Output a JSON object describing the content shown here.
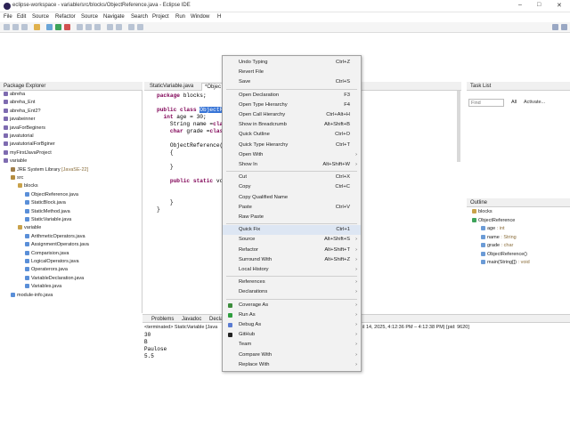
{
  "window": {
    "title": "eclipse-workspace - variable/src/blocks/ObjectReference.java - Eclipse IDE",
    "minimize": "–",
    "maximize": "□",
    "close": "✕"
  },
  "menubar": [
    "File",
    "Edit",
    "Source",
    "Refactor",
    "Source",
    "Navigate",
    "Search",
    "Project",
    "Run",
    "Window",
    "H"
  ],
  "package_explorer": {
    "tab_label": "Package Explorer",
    "items": [
      {
        "label": "abreha",
        "depth": 0,
        "type": "proj"
      },
      {
        "label": "abreha_Ent",
        "depth": 0,
        "type": "proj"
      },
      {
        "label": "abreha_Ent2?",
        "depth": 0,
        "type": "proj"
      },
      {
        "label": "javabeinner",
        "depth": 0,
        "type": "proj"
      },
      {
        "label": "javaForBeginers",
        "depth": 0,
        "type": "proj"
      },
      {
        "label": "javatutorial",
        "depth": 0,
        "type": "proj"
      },
      {
        "label": "javatutorialForBginer",
        "depth": 0,
        "type": "proj"
      },
      {
        "label": "myFirstJavaProject",
        "depth": 0,
        "type": "proj"
      },
      {
        "label": "variable",
        "depth": 0,
        "type": "proj"
      },
      {
        "label": "JRE System Library",
        "suffix": "[JavaSE-22]",
        "depth": 1,
        "type": "lib"
      },
      {
        "label": "src",
        "depth": 1,
        "type": "src"
      },
      {
        "label": "blocks",
        "depth": 2,
        "type": "pkg"
      },
      {
        "label": "ObjectReference.java",
        "depth": 3,
        "type": "file"
      },
      {
        "label": "StaticBlock.java",
        "depth": 3,
        "type": "file"
      },
      {
        "label": "StaticMethod.java",
        "depth": 3,
        "type": "file"
      },
      {
        "label": "StaticVariable.java",
        "depth": 3,
        "type": "file"
      },
      {
        "label": "variable",
        "depth": 2,
        "type": "pkg"
      },
      {
        "label": "ArithmeticOperators.java",
        "depth": 3,
        "type": "file"
      },
      {
        "label": "AssignmentOperators.java",
        "depth": 3,
        "type": "file"
      },
      {
        "label": "Comparision.java",
        "depth": 3,
        "type": "file"
      },
      {
        "label": "LogicalOperators.java",
        "depth": 3,
        "type": "file"
      },
      {
        "label": "Operaterors.java",
        "depth": 3,
        "type": "file"
      },
      {
        "label": "VariableDeclaration.java",
        "depth": 3,
        "type": "file"
      },
      {
        "label": "Variables.java",
        "depth": 3,
        "type": "file"
      },
      {
        "label": "module-info.java",
        "depth": 1,
        "type": "file"
      }
    ]
  },
  "editor": {
    "tabs": [
      "StaticVariable.java",
      "*Objec"
    ],
    "lines": [
      "package blocks;",
      "",
      "public class ObjectR",
      "  int age = 30;",
      "    String name =\"pa",
      "    char grade ='A';",
      "",
      "    ObjectReference(",
      "    {",
      "",
      "    }",
      "",
      "    public static vo",
      "",
      "",
      "    }",
      "}"
    ]
  },
  "context_menu": {
    "items": [
      {
        "label": "Undo Typing",
        "key": "Ctrl+Z"
      },
      {
        "label": "Revert File",
        "key": ""
      },
      {
        "label": "Save",
        "key": "Ctrl+S"
      },
      {
        "sep": true
      },
      {
        "label": "Open Declaration",
        "key": "F3"
      },
      {
        "label": "Open Type Hierarchy",
        "key": "F4"
      },
      {
        "label": "Open Call Hierarchy",
        "key": "Ctrl+Alt+H"
      },
      {
        "label": "Show in Breadcrumb",
        "key": "Alt+Shift+B"
      },
      {
        "label": "Quick Outline",
        "key": "Ctrl+O"
      },
      {
        "label": "Quick Type Hierarchy",
        "key": "Ctrl+T"
      },
      {
        "label": "Open With",
        "key": "",
        "arrow": true
      },
      {
        "label": "Show In",
        "key": "Alt+Shift+W",
        "arrow": true
      },
      {
        "sep": true
      },
      {
        "label": "Cut",
        "key": "Ctrl+X"
      },
      {
        "label": "Copy",
        "key": "Ctrl+C"
      },
      {
        "label": "Copy Qualified Name",
        "key": ""
      },
      {
        "label": "Paste",
        "key": "Ctrl+V"
      },
      {
        "label": "Raw Paste",
        "key": ""
      },
      {
        "sep": true
      },
      {
        "label": "Quick Fix",
        "key": "Ctrl+1",
        "highlight": true
      },
      {
        "label": "Source",
        "key": "Alt+Shift+S",
        "arrow": true
      },
      {
        "label": "Refactor",
        "key": "Alt+Shift+T",
        "arrow": true
      },
      {
        "label": "Surround With",
        "key": "Alt+Shift+Z",
        "arrow": true
      },
      {
        "label": "Local History",
        "key": "",
        "arrow": true
      },
      {
        "sep": true
      },
      {
        "label": "References",
        "key": "",
        "arrow": true
      },
      {
        "label": "Declarations",
        "key": "",
        "arrow": true
      },
      {
        "sep": true
      },
      {
        "label": "Coverage As",
        "key": "",
        "arrow": true,
        "icon": "#3c8c3c"
      },
      {
        "label": "Run As",
        "key": "",
        "arrow": true,
        "icon": "#2e9e3e"
      },
      {
        "label": "Debug As",
        "key": "",
        "arrow": true,
        "icon": "#5a7bd1"
      },
      {
        "label": "GitHub",
        "key": "",
        "arrow": true,
        "icon": "#222222"
      },
      {
        "label": "Team",
        "key": "",
        "arrow": true
      },
      {
        "label": "Compare With",
        "key": "",
        "arrow": true
      },
      {
        "label": "Replace With",
        "key": "",
        "arrow": true
      }
    ]
  },
  "task_list": {
    "tab_label": "Task List",
    "find_placeholder": "Find",
    "all_label": "All",
    "activate_label": "Activate..."
  },
  "outline": {
    "tab_label": "Outline",
    "items": [
      {
        "label": "blocks",
        "suffix": "",
        "depth": 0
      },
      {
        "label": "ObjectReference",
        "suffix": "",
        "depth": 0
      },
      {
        "label": "age",
        "suffix": ": int",
        "depth": 1
      },
      {
        "label": "name",
        "suffix": ": String",
        "depth": 1
      },
      {
        "label": "grade",
        "suffix": ": char",
        "depth": 1
      },
      {
        "label": "ObjectReference()",
        "suffix": "",
        "depth": 1
      },
      {
        "label": "main(String[])",
        "suffix": ": void",
        "depth": 1
      }
    ]
  },
  "bottom_panel": {
    "tabs": [
      "Problems",
      "Javadoc",
      "Decla"
    ],
    "status_left": "<terminated> StaticVariable [Java",
    "status_right": "il 14, 2025, 4:12:36 PM – 4:12:38 PM) [pid: 9620]",
    "output": [
      "30",
      "B",
      "Paulose",
      "5.5"
    ]
  },
  "colors": {
    "selection": "#3875d7",
    "menu_highlight": "#dde6f3",
    "keyword": "#7f0055",
    "string": "#2a00ff"
  }
}
